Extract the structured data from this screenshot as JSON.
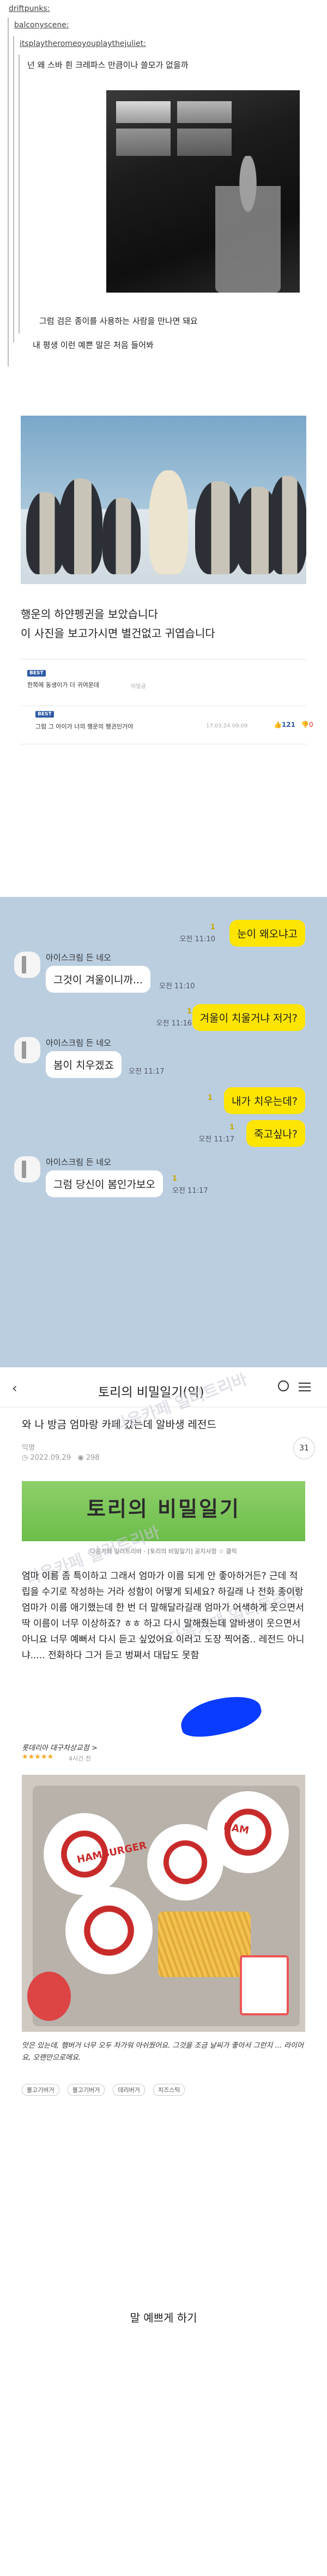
{
  "section1": {
    "user1": "driftpunks:",
    "user2": "balconyscene:",
    "user3": "itsplaytheromeoyouplaythejuliet:",
    "quote": "넌 왜 스바 흰 크레파스 만큼이나 쓸모가 없을까",
    "line2": "그럼 검은 종이를 사용하는 사람을 만나면 돼요",
    "line3": "내 평생 이런 예쁜 말은 처음 들어봐"
  },
  "section2": {
    "post_line1": "행운의 하얀펭귄을 보았습니다",
    "post_line2": "이 사진을 보고가시면 별건없고 귀엽습니다",
    "best_label": "BEST",
    "comment1": "한쪽에 동생이가 더 귀여운데",
    "comment1_meta": "비밀글",
    "comment2": "그럼 그 아이가 너의 행운의 펭귄인거야",
    "comment2_meta": "17.03.24 09:09",
    "like_count": "121",
    "dislike_count": "0"
  },
  "section3": {
    "sender": "아이스크림 든 네오",
    "messages": [
      {
        "side": "me",
        "text": "눈이 왜오냐고",
        "time": "오전 11:10",
        "read": "1"
      },
      {
        "side": "you",
        "text": "그것이 겨울이니까...",
        "time": "오전 11:10",
        "read": ""
      },
      {
        "side": "me",
        "text": "겨울이 치울거냐 저거?",
        "time": "오전 11:16",
        "read": "1"
      },
      {
        "side": "you",
        "text": "봄이 치우겠죠",
        "time": "오전 11:17",
        "read": ""
      },
      {
        "side": "me",
        "text": "내가 치우는데?",
        "time": "",
        "read": "1"
      },
      {
        "side": "me",
        "text": "죽고싶나?",
        "time": "오전 11:17",
        "read": "1"
      },
      {
        "side": "you",
        "text": "그럼 당신이 봄인가보오",
        "time": "오전 11:17",
        "read": "1"
      }
    ]
  },
  "section4": {
    "header_title": "토리의 비밀일기(익)",
    "post_title": "와 나 방금 엄마랑 카페 갔는데 알바생 레전드",
    "author": "익명",
    "date": "2022.09.29",
    "views": "298",
    "comments": "31",
    "banner_title": "토리의 비밀일기",
    "banner_sub": "다음카페 일러트리바 - [토리의 비밀일기] 공지사항 ☆ 클릭",
    "watermark": "다음카페 일러트리바",
    "body": "엄마 이름 좀 특이하고 그래서 엄마가 이름 되게 안 좋아하거든? 근데 적립을 수기로 작성하는 거라 성함이 어떻게 되세요? 하길래 나 전화 종이랑 엄마가 이름 애기했는데 한 번 더 말해달라길래 엄마가 어색하게 웃으면서 딱 이름이 너무 이상하죠? ㅎㅎ 하고 다시 말해줬는데 알바생이 웃으면서 아니요 너무 예뻐서 다시 듣고 싶었어요 이러고 도장 찍어줌.. 레전드 아니냐..... 전화하다 그거 듣고 벙쪄서 대답도 못함",
    "review_shop": "롯데리아 대구차상교점 >",
    "review_stars": "★★★★★",
    "review_date": "4시간 전",
    "review_text": "맛은 있는데, 햄버거 너무 오두 차가워 아쉬웠어요. 그것을 조금 날씨가 좋아서 그런지 ... 라이어요, 오랜만으로에요.",
    "tags": [
      "불고기버거",
      "불고기버거",
      "데리버거",
      "치즈스틱"
    ],
    "caption": "말 예쁘게 하기",
    "wrapper_label": "HAMBURGER",
    "burger_brand": "HAM"
  }
}
